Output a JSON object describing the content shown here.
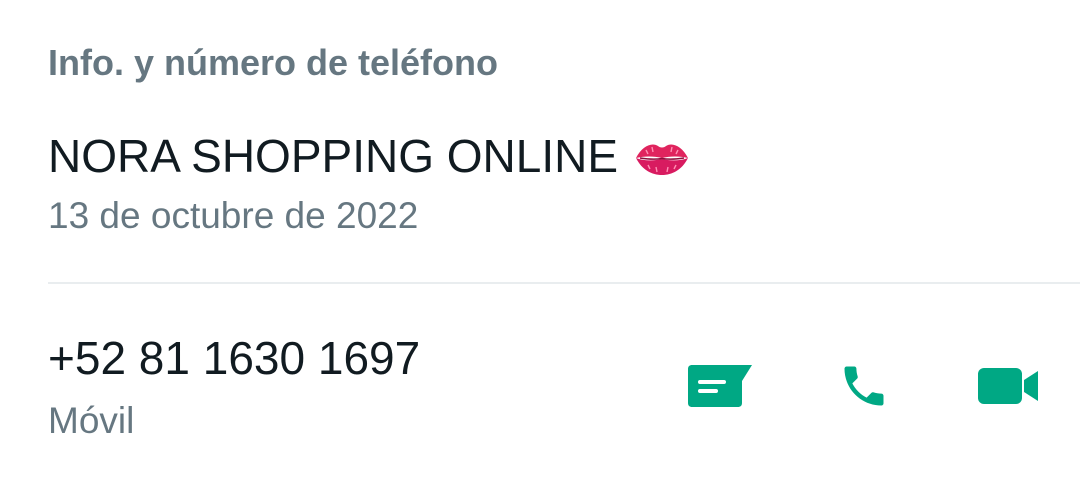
{
  "section": {
    "title": "Info. y número de teléfono"
  },
  "about": {
    "text": "NORA SHOPPING ONLINE",
    "emoji_icon": "kiss-mark-icon",
    "date": "13 de octubre de 2022"
  },
  "phone": {
    "number": "+52 81 1630 1697",
    "type": "Móvil"
  },
  "actions": {
    "message_icon": "message-icon",
    "call_icon": "phone-icon",
    "video_icon": "video-camera-icon"
  },
  "colors": {
    "accent": "#00a884",
    "primary_text": "#111b21",
    "secondary_text": "#667781",
    "divider": "#e9edef",
    "emoji": "#e0245e"
  }
}
